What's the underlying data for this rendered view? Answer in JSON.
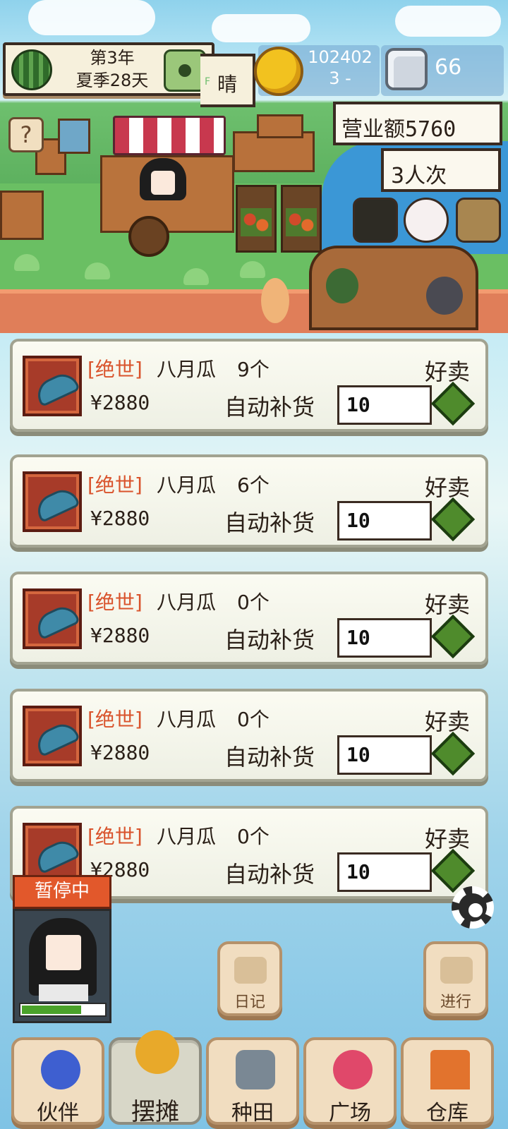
{
  "header": {
    "year_label": "第3年",
    "season_day_label": "夏季28天",
    "weather_label": "晴",
    "weather_small": "F",
    "coins": "102402\n3 -",
    "coins_line1": "102402",
    "coins_line2": "3 -",
    "gems": "66",
    "revenue": "营业额5760",
    "visitors": "3人次",
    "help_glyph": "?"
  },
  "items": [
    {
      "rarity": "[绝世]",
      "name": "八月瓜",
      "count": "9个",
      "tag": "好卖",
      "price": "¥2880",
      "restock_label": "自动补货",
      "restock_value": "10"
    },
    {
      "rarity": "[绝世]",
      "name": "八月瓜",
      "count": "6个",
      "tag": "好卖",
      "price": "¥2880",
      "restock_label": "自动补货",
      "restock_value": "10"
    },
    {
      "rarity": "[绝世]",
      "name": "八月瓜",
      "count": "0个",
      "tag": "好卖",
      "price": "¥2880",
      "restock_label": "自动补货",
      "restock_value": "10"
    },
    {
      "rarity": "[绝世]",
      "name": "八月瓜",
      "count": "0个",
      "tag": "好卖",
      "price": "¥2880",
      "restock_label": "自动补货",
      "restock_value": "10"
    },
    {
      "rarity": "[绝世]",
      "name": "八月瓜",
      "count": "0个",
      "tag": "好卖",
      "price": "¥2880",
      "restock_label": "自动补货",
      "restock_value": "10"
    }
  ],
  "hud": {
    "paused_label": "暂停中",
    "stamina_fraction": 0.72,
    "diary_label": "日记",
    "proceed_label": "进行"
  },
  "nav": {
    "partner": "伙伴",
    "stall": "摆摊",
    "farm": "种田",
    "plaza": "广场",
    "warehouse": "仓库"
  },
  "colors": {
    "rarity": "#d9532c",
    "confirm": "#4f8b2c",
    "paused": "#e2582b"
  }
}
